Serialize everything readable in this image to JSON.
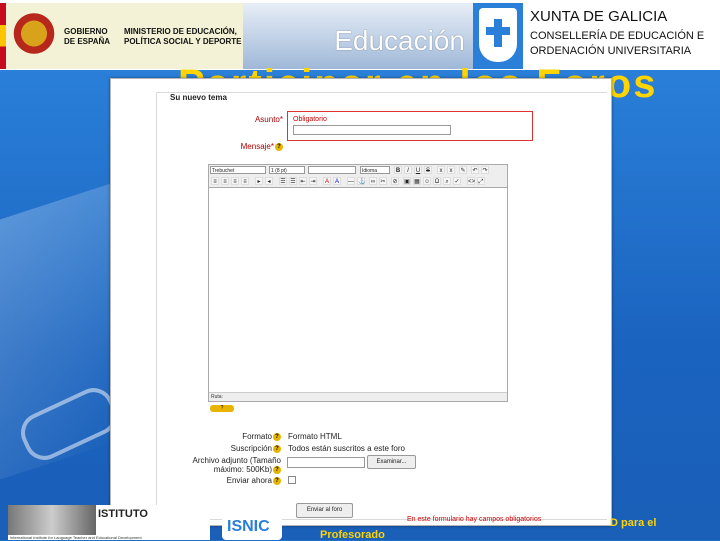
{
  "banner": {
    "gov_line1": "GOBIERNO DE ESPAÑA",
    "gov_line2": "MINISTERIO DE EDUCACIÓN, POLÍTICA SOCIAL Y DEPORTE",
    "education": "Educación",
    "xunta_title": "XUNTA DE GALICIA",
    "xunta_sub": "CONSELLERÍA DE EDUCACIÓN E ORDENACIÓN UNIVERSITARIA"
  },
  "heading": "Participar en los Foros",
  "form": {
    "legend": "Su nuevo tema",
    "subject_label": "Asunto*",
    "subject_required": "Obligatorio",
    "subject_value": "",
    "message_label": "Mensaje*",
    "toolbar": {
      "font": "Trebuchet",
      "size": "1 (8 pt)",
      "format": "",
      "language": "Idioma",
      "bold": "B",
      "italic": "I",
      "underline": "U",
      "strike": "S"
    },
    "path_label": "Ruta:",
    "about_label": "?",
    "format_label": "Formato",
    "format_value": "Formato HTML",
    "subscription_label": "Suscripción",
    "subscription_value": "Todos están suscritos a este foro",
    "attachment_label": "Archivo adjunto (Tamaño máximo: 500Kb)",
    "browse_button": "Examinar...",
    "send_now_label": "Enviar ahora",
    "submit_button": "Enviar al foro",
    "required_note": "En este formulario hay campos obligatorios"
  },
  "footer": {
    "logo1_text": "ISTITUTO",
    "logo1_small": "International Institute for Language Teacher and Educational Development",
    "logo2_text": "ISNIC",
    "line1": "D para el",
    "line2": "Profesorado"
  },
  "colors": {
    "background": "#1f6fc4",
    "heading": "#ffd400",
    "required": "#cc0000"
  }
}
